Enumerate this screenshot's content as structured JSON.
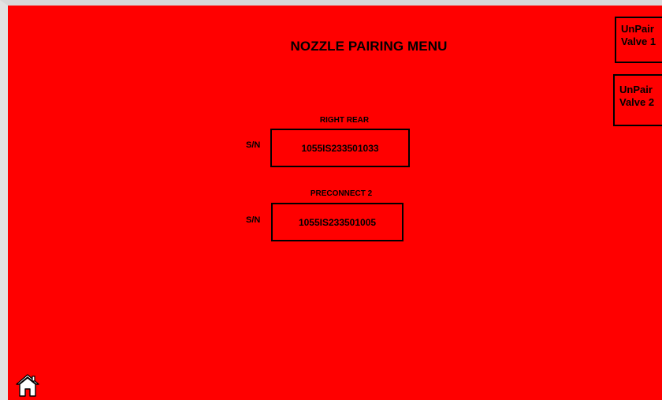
{
  "screen": {
    "title": "NOZZLE PAIRING MENU",
    "background_color": "#ff0000"
  },
  "unpair_buttons": [
    {
      "line1": "UnPair",
      "line2": "Valve 1"
    },
    {
      "line1": "UnPair",
      "line2": "Valve 2"
    }
  ],
  "nozzles": [
    {
      "name": "RIGHT REAR",
      "sn_label": "S/N",
      "serial": "1055IS233501033"
    },
    {
      "name": "PRECONNECT 2",
      "sn_label": "S/N",
      "serial": "1055IS233501005"
    }
  ],
  "home": {
    "icon": "home-icon"
  }
}
